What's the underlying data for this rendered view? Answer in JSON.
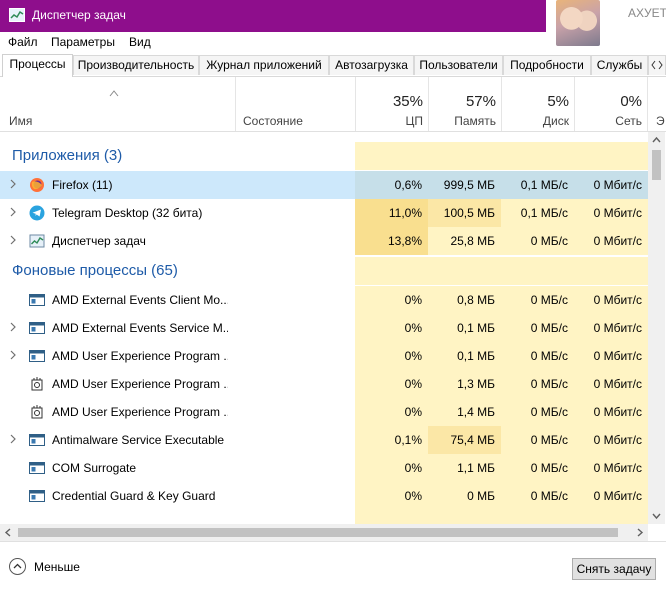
{
  "window": {
    "title": "Диспетчер задач",
    "user_name": "АХУЕТ"
  },
  "menu": [
    "Файл",
    "Параметры",
    "Вид"
  ],
  "tabs": [
    "Процессы",
    "Производительность",
    "Журнал приложений",
    "Автозагрузка",
    "Пользователи",
    "Подробности",
    "Службы"
  ],
  "columns": {
    "name": "Имя",
    "status": "Состояние",
    "cpu": {
      "pct": "35%",
      "label": "ЦП"
    },
    "memory": {
      "pct": "57%",
      "label": "Память"
    },
    "disk": {
      "pct": "5%",
      "label": "Диск"
    },
    "network": {
      "pct": "0%",
      "label": "Сеть"
    },
    "extra_label": "Э"
  },
  "groups": {
    "apps": "Приложения (3)",
    "background": "Фоновые процессы (65)"
  },
  "apps": [
    {
      "name": "Firefox (11)",
      "cpu": "0,6%",
      "mem": "999,5 МБ",
      "disk": "0,1 МБ/с",
      "net": "0 Мбит/с",
      "icon": "firefox-icon",
      "expandable": true,
      "selected": true
    },
    {
      "name": "Telegram Desktop (32 бита)",
      "cpu": "11,0%",
      "mem": "100,5 МБ",
      "disk": "0,1 МБ/с",
      "net": "0 Мбит/с",
      "icon": "telegram-icon",
      "expandable": true
    },
    {
      "name": "Диспетчер задач",
      "cpu": "13,8%",
      "mem": "25,8 МБ",
      "disk": "0 МБ/с",
      "net": "0 Мбит/с",
      "icon": "task-manager-icon",
      "expandable": true
    }
  ],
  "background": [
    {
      "name": "AMD External Events Client Mo...",
      "cpu": "0%",
      "mem": "0,8 МБ",
      "disk": "0 МБ/с",
      "net": "0 Мбит/с",
      "icon": "service-window-icon",
      "expandable": false
    },
    {
      "name": "AMD External Events Service M...",
      "cpu": "0%",
      "mem": "0,1 МБ",
      "disk": "0 МБ/с",
      "net": "0 Мбит/с",
      "icon": "service-window-icon",
      "expandable": true
    },
    {
      "name": "AMD User Experience Program ...",
      "cpu": "0%",
      "mem": "0,1 МБ",
      "disk": "0 МБ/с",
      "net": "0 Мбит/с",
      "icon": "service-window-icon",
      "expandable": true
    },
    {
      "name": "AMD User Experience Program ...",
      "cpu": "0%",
      "mem": "1,3 МБ",
      "disk": "0 МБ/с",
      "net": "0 Мбит/с",
      "icon": "gear-process-icon",
      "expandable": false
    },
    {
      "name": "AMD User Experience Program ...",
      "cpu": "0%",
      "mem": "1,4 МБ",
      "disk": "0 МБ/с",
      "net": "0 Мбит/с",
      "icon": "gear-process-icon",
      "expandable": false
    },
    {
      "name": "Antimalware Service Executable",
      "cpu": "0,1%",
      "mem": "75,4 МБ",
      "disk": "0 МБ/с",
      "net": "0 Мбит/с",
      "icon": "service-window-icon",
      "expandable": true
    },
    {
      "name": "COM Surrogate",
      "cpu": "0%",
      "mem": "1,1 МБ",
      "disk": "0 МБ/с",
      "net": "0 Мбит/с",
      "icon": "service-window-icon",
      "expandable": false
    },
    {
      "name": "Credential Guard & Key Guard",
      "cpu": "0%",
      "mem": "0 МБ",
      "disk": "0 МБ/с",
      "net": "0 Мбит/с",
      "icon": "service-window-icon",
      "expandable": false
    }
  ],
  "footer": {
    "less_label": "Меньше",
    "end_task_label": "Снять задачу"
  },
  "colors": {
    "titlebar": "#8e0e8c",
    "heat_light": "#fff4c4",
    "heat_mid": "#fbe7a6",
    "heat_strong": "#f9df8f",
    "selected_row": "#cde8fb",
    "group_text": "#1e5ba8"
  }
}
